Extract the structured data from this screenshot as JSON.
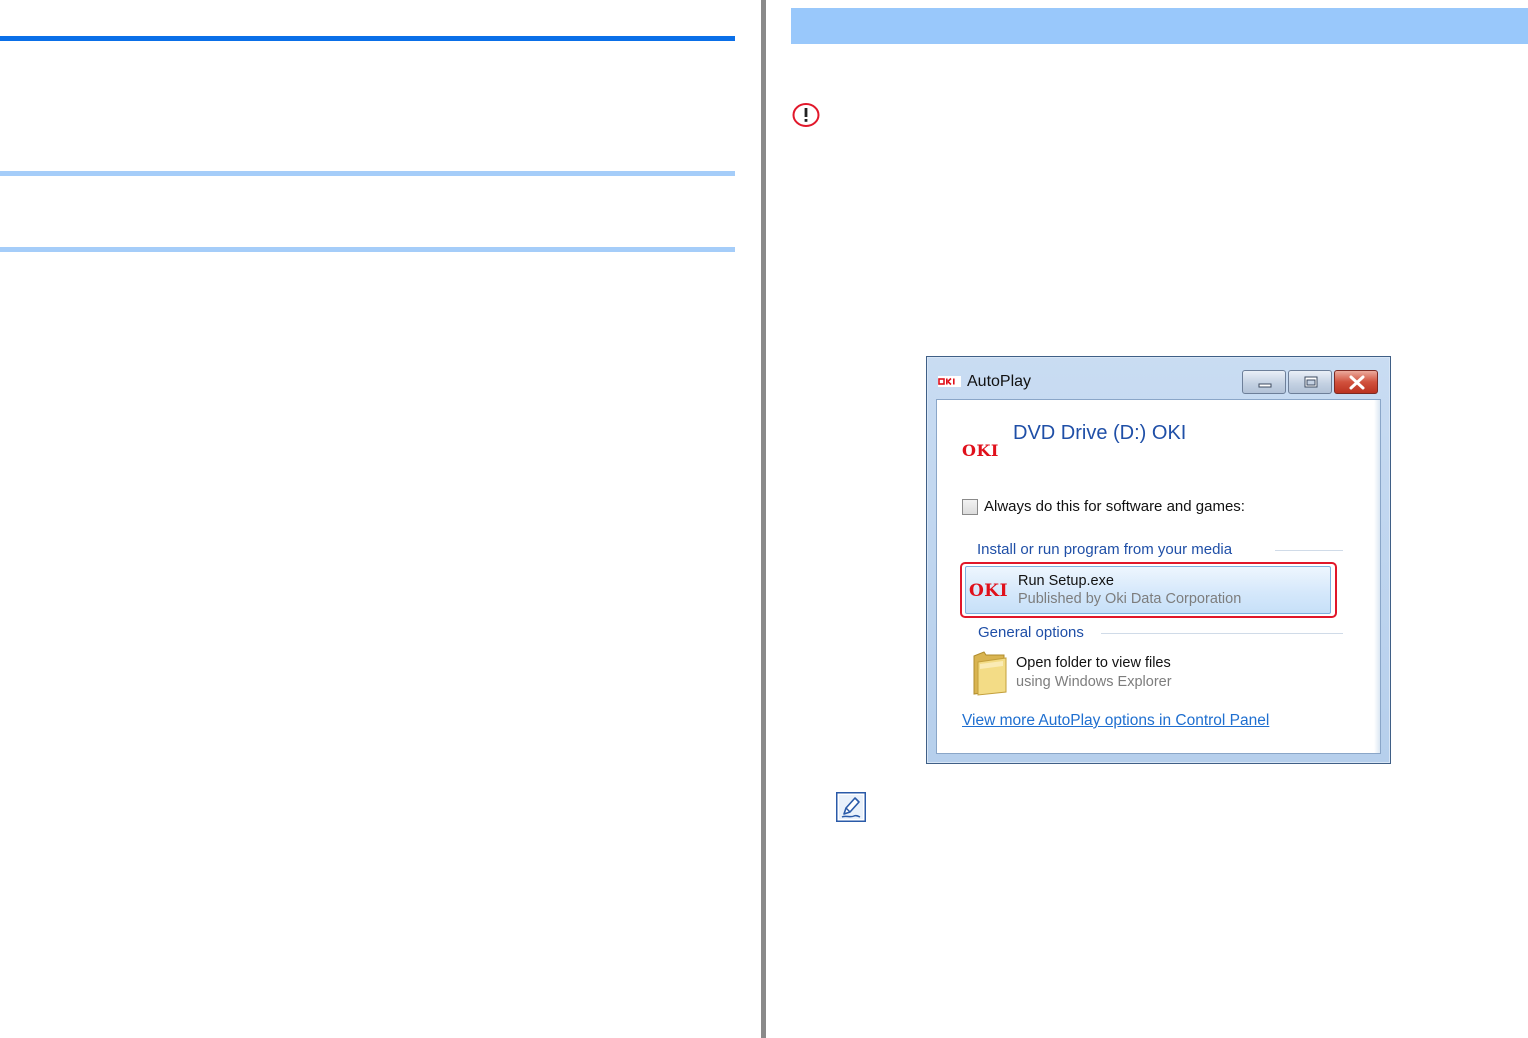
{
  "manual": {
    "caution_icon": "caution-icon",
    "note_icon": "note-pencil-icon",
    "colors": {
      "primary_rule": "#0a6fe8",
      "secondary_rule": "#a5cdf9",
      "section_band": "#99c8fb",
      "highlight": "#e1172a"
    }
  },
  "autoplay": {
    "window_title": "AutoPlay",
    "window_logo": "oki-logo",
    "drive": {
      "logo": "OKI",
      "title": "DVD Drive (D:) OKI"
    },
    "always_checkbox": {
      "label": "Always do this for software and games:",
      "checked": false
    },
    "install_group": {
      "heading": "Install or run program from your media",
      "option": {
        "logo": "OKI",
        "title": "Run Setup.exe",
        "subtitle": "Published by Oki Data Corporation"
      }
    },
    "general_group": {
      "heading": "General options",
      "option": {
        "icon": "folder-icon",
        "title": "Open folder to view files",
        "subtitle": "using Windows Explorer"
      }
    },
    "more_link": "View more AutoPlay options in Control Panel",
    "window_buttons": [
      "minimize-icon",
      "maximize-icon",
      "close-icon"
    ]
  }
}
